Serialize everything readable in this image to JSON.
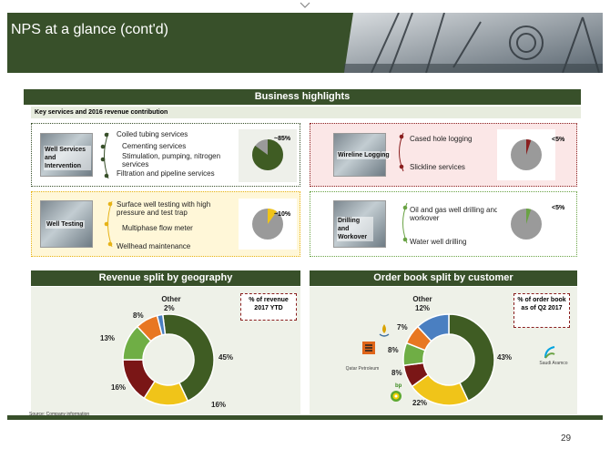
{
  "slide": {
    "title": "NPS at a glance (cont'd)",
    "main_header": "Business highlights",
    "sub_header": "Key services and 2016 revenue contribution",
    "source": "Source: Company information",
    "page_number": "29"
  },
  "services": {
    "well_services": {
      "label": "Well Services and Intervention",
      "items": [
        "Coiled tubing services",
        "Cementing services",
        "Stimulation, pumping, nitrogen services",
        "Filtration and pipeline services"
      ],
      "share_label": "~85%",
      "share_fraction": 0.85
    },
    "wireline": {
      "label": "Wireline Logging",
      "items": [
        "Cased hole logging",
        "Slickline services"
      ],
      "share_label": "<5%",
      "share_fraction": 0.05
    },
    "well_testing": {
      "label": "Well Testing",
      "items": [
        "Surface well testing with high pressure and test trap",
        "Multiphase flow meter",
        "Wellhead maintenance"
      ],
      "share_label": "~10%",
      "share_fraction": 0.1
    },
    "drilling": {
      "label": "Drilling and Workover",
      "items": [
        "Oil and gas well drilling and workover",
        "Water well drilling"
      ],
      "share_label": "<5%",
      "share_fraction": 0.05
    }
  },
  "revenue": {
    "header": "Revenue split by geography",
    "callout": "% of revenue 2017 YTD",
    "other_label": "Other",
    "labels": [
      "45%",
      "16%",
      "16%",
      "13%",
      "8%",
      "2%"
    ]
  },
  "orderbook": {
    "header": "Order book split by customer",
    "callout": "% of order book as of Q2 2017",
    "other_label": "Other",
    "labels": [
      "43%",
      "22%",
      "8%",
      "8%",
      "7%",
      "12%"
    ],
    "logos": [
      "Saudi Aramco",
      "Qatar Petroleum",
      "bp"
    ]
  },
  "chart_data": [
    {
      "type": "pie",
      "title": "Revenue split by geography",
      "categories": [
        "",
        "",
        "",
        "",
        "",
        "Other"
      ],
      "values": [
        45,
        16,
        16,
        13,
        8,
        2
      ],
      "colors": [
        "#3f5c23",
        "#f0c419",
        "#7a1616",
        "#6fae45",
        "#e87722",
        "#4a7fc1"
      ]
    },
    {
      "type": "pie",
      "title": "Order book split by customer",
      "categories": [
        "",
        "",
        "",
        "",
        "",
        "Other"
      ],
      "values": [
        43,
        22,
        8,
        8,
        7,
        12
      ],
      "colors": [
        "#3f5c23",
        "#f0c419",
        "#7a1616",
        "#6fae45",
        "#e87722",
        "#4a7fc1"
      ]
    }
  ],
  "colors": {
    "brand_green": "#38502a",
    "light_green": "#6aa345",
    "red": "#8a1f1f",
    "yellow": "#e6b317"
  }
}
